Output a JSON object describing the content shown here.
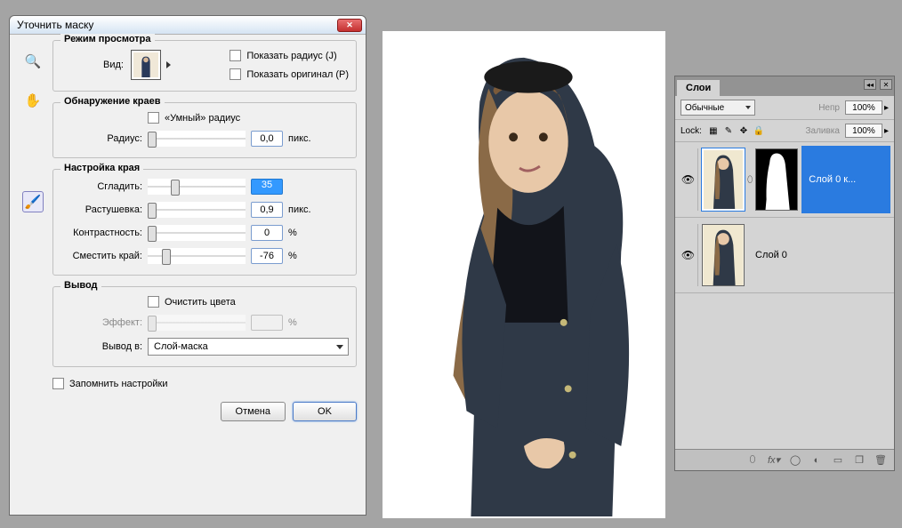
{
  "dialog": {
    "title": "Уточнить маску",
    "view_section": {
      "legend": "Режим просмотра",
      "view_label": "Вид:",
      "show_radius": "Показать радиус (J)",
      "show_original": "Показать оригинал (P)"
    },
    "edge_section": {
      "legend": "Обнаружение краев",
      "smart_radius": "«Умный» радиус",
      "radius_label": "Радиус:",
      "radius_value": "0,0",
      "radius_unit": "пикс."
    },
    "adjust_section": {
      "legend": "Настройка края",
      "smooth_label": "Сгладить:",
      "smooth_value": "35",
      "feather_label": "Растушевка:",
      "feather_value": "0,9",
      "feather_unit": "пикс.",
      "contrast_label": "Контрастность:",
      "contrast_value": "0",
      "contrast_unit": "%",
      "shift_label": "Сместить край:",
      "shift_value": "-76",
      "shift_unit": "%"
    },
    "output_section": {
      "legend": "Вывод",
      "decontaminate": "Очистить цвета",
      "amount_label": "Эффект:",
      "amount_unit": "%",
      "output_to_label": "Вывод в:",
      "output_to_value": "Слой-маска"
    },
    "remember": "Запомнить настройки",
    "cancel": "Отмена",
    "ok": "OK"
  },
  "layers": {
    "tab": "Слои",
    "blend_mode": "Обычные",
    "opacity_label": "Непр",
    "opacity": "100%",
    "lock_label": "Lock:",
    "fill_label": "Заливка",
    "fill": "100%",
    "layer1_name": "Слой 0 к...",
    "layer2_name": "Слой 0"
  }
}
